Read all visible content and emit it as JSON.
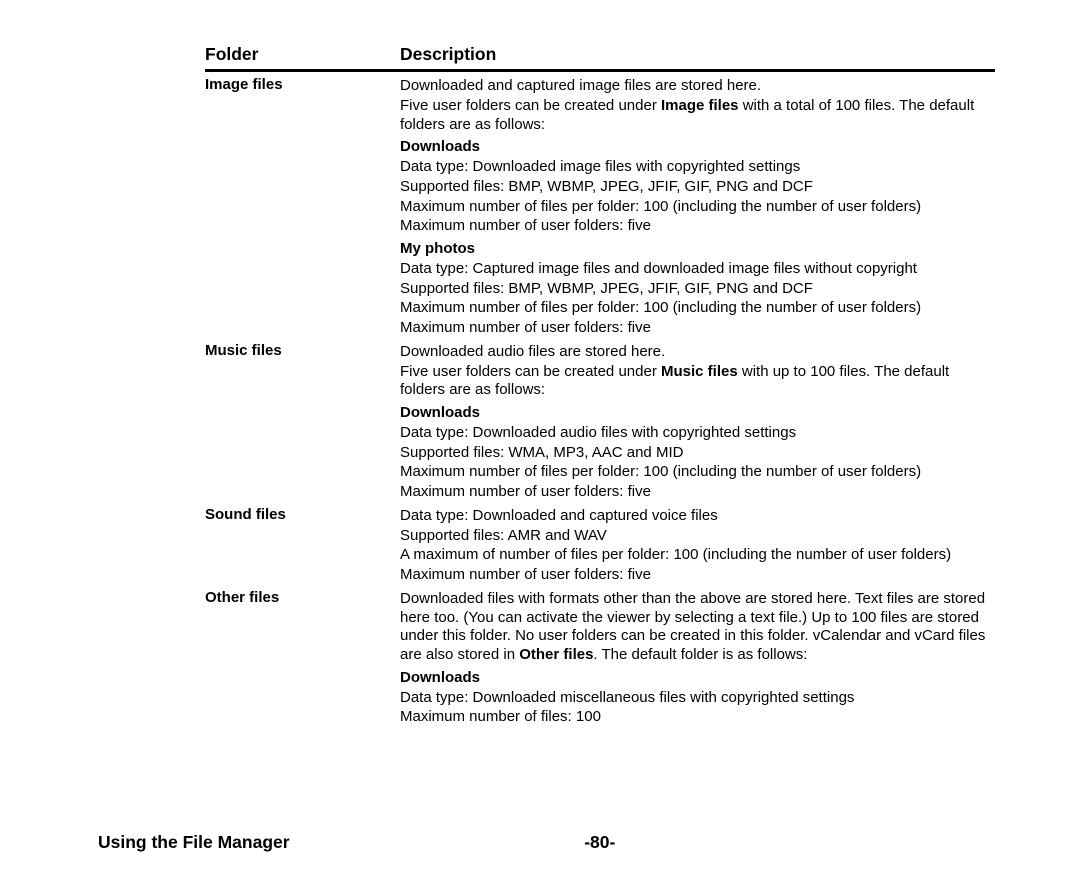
{
  "table": {
    "headers": {
      "folder": "Folder",
      "description": "Description"
    }
  },
  "rows": {
    "image": {
      "label": "Image files",
      "line1": "Downloaded and captured image files are stored here.",
      "line2a": "Five user folders can be created under ",
      "line2b": "Image files",
      "line2c": " with a total of 100 files. The default folders are as follows:",
      "downloads": {
        "title": "Downloads",
        "l1": "Data type: Downloaded image files with copyrighted settings",
        "l2": "Supported files: BMP, WBMP, JPEG, JFIF, GIF, PNG and DCF",
        "l3": "Maximum number of files per folder: 100 (including the number of user folders)",
        "l4": "Maximum number of user folders: five"
      },
      "myphotos": {
        "title": "My photos",
        "l1": "Data type: Captured image files and downloaded image files without copyright",
        "l2": "Supported files: BMP, WBMP, JPEG, JFIF, GIF, PNG and DCF",
        "l3": "Maximum number of files per folder: 100 (including the number of user folders)",
        "l4": "Maximum number of user folders: five"
      }
    },
    "music": {
      "label": "Music files",
      "line1": "Downloaded audio files are stored here.",
      "line2a": "Five user folders can be created under ",
      "line2b": "Music files",
      "line2c": " with up to 100 files. The default folders are as follows:",
      "downloads": {
        "title": "Downloads",
        "l1": "Data type: Downloaded audio files with copyrighted settings",
        "l2": "Supported files: WMA, MP3, AAC and MID",
        "l3": "Maximum number of files per folder: 100 (including the number of user folders)",
        "l4": "Maximum number of user folders: five"
      }
    },
    "sound": {
      "label": "Sound files",
      "l1": "Data type: Downloaded and captured voice files",
      "l2": "Supported files: AMR and WAV",
      "l3": "A maximum of number of files per folder: 100 (including the number of user folders)",
      "l4": "Maximum number of user folders: five"
    },
    "other": {
      "label": "Other files",
      "line1a": "Downloaded files with formats other than the above are stored here. Text files are stored here too. (You can activate the viewer by selecting a text file.) Up to 100 files are stored under this folder. No user folders can be created in this folder. vCalendar and vCard files are also stored in ",
      "line1b": "Other files",
      "line1c": ". The default folder is as follows:",
      "downloads": {
        "title": "Downloads",
        "l1": "Data type: Downloaded miscellaneous files with copyrighted settings",
        "l2": "Maximum number of files: 100"
      }
    }
  },
  "footer": {
    "title": "Using the File Manager",
    "page": "-80-"
  }
}
